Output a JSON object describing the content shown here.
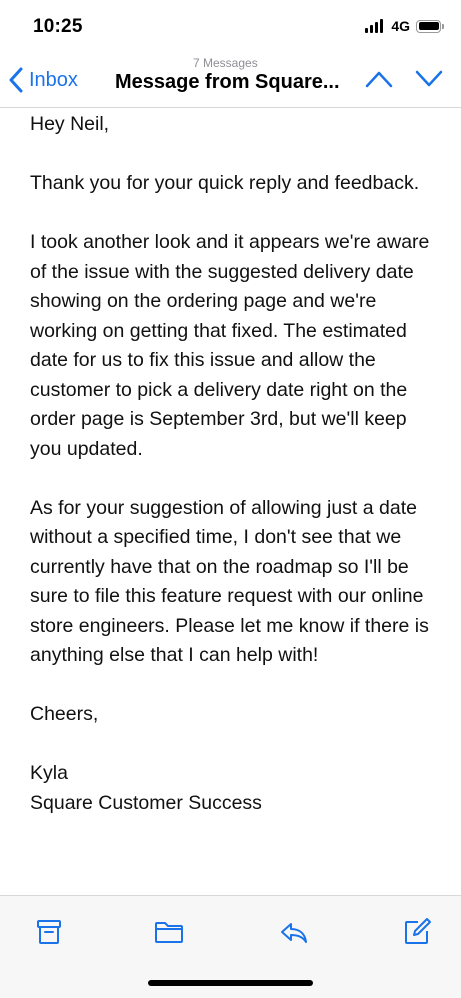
{
  "status_bar": {
    "time": "10:25",
    "network": "4G",
    "battery_level": 1.0
  },
  "nav": {
    "back_label": "Inbox",
    "message_count": "7 Messages",
    "title": "Message from Square...",
    "accent_color": "#1a73e8"
  },
  "email": {
    "greeting": "Hey Neil,",
    "paragraphs": [
      "Thank you for your quick reply and feedback.",
      "I took another look and it appears we're aware of the issue with the suggested delivery date showing on the ordering page and we're working on getting that fixed. The estimated date for us to fix this issue and allow the customer to pick a delivery date right on the order page is September 3rd, but we'll keep you updated.",
      "As for your suggestion of allowing just a date without a specified time, I don't see that we currently have that on the roadmap so I'll be sure to file this feature request with our online store engineers. Please let me know if there is anything else that I can help with!"
    ],
    "closing": "Cheers,",
    "signature_name": "Kyla",
    "signature_team": "Square Customer Success"
  },
  "toolbar": {
    "icons": [
      "archive-icon",
      "folder-icon",
      "reply-icon",
      "compose-icon"
    ]
  }
}
